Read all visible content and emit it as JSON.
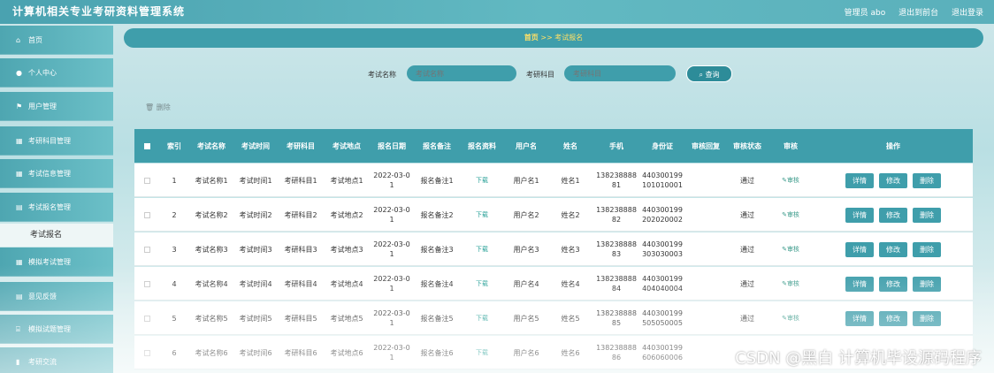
{
  "app": {
    "title": "计算机相关专业考研资料管理系统",
    "user": "管理员 abo",
    "front_link": "退出到前台",
    "logout": "退出登录"
  },
  "sidebar": {
    "items": [
      {
        "label": "首页",
        "icon": "home-icon"
      },
      {
        "label": "个人中心",
        "icon": "user-icon"
      },
      {
        "label": "用户管理",
        "icon": "flag-icon"
      },
      {
        "label": "考研科目管理",
        "icon": "grid-icon"
      },
      {
        "label": "考试信息管理",
        "icon": "grid-icon"
      },
      {
        "label": "考试报名管理",
        "icon": "doc-icon"
      },
      {
        "label": "模拟考试管理",
        "icon": "grid-icon"
      },
      {
        "label": "意见反馈",
        "icon": "doc-icon"
      },
      {
        "label": "模拟试题管理",
        "icon": "bank-icon"
      },
      {
        "label": "考研交流",
        "icon": "chart-icon"
      }
    ],
    "active_sub": "考试报名"
  },
  "breadcrumb": {
    "home": "首页",
    "sep": ">>",
    "current": "考试报名"
  },
  "search": {
    "name_label": "考试名称",
    "name_placeholder": "考试名称",
    "subject_label": "考研科目",
    "subject_placeholder": "考研科目",
    "button": "查询"
  },
  "toolbar": {
    "delete": "删除"
  },
  "table": {
    "headers": [
      "索引",
      "考试名称",
      "考试时间",
      "考研科目",
      "考试地点",
      "报名日期",
      "报名备注",
      "报名资料",
      "用户名",
      "姓名",
      "手机",
      "身份证",
      "审核回复",
      "审核状态",
      "审核",
      "操作"
    ],
    "rows": [
      {
        "idx": "1",
        "name": "考试名称1",
        "time": "考试时间1",
        "subject": "考研科目1",
        "place": "考试地点1",
        "date1": "2022-03-0",
        "date2": "1",
        "note": "报名备注1",
        "file": "下载",
        "user": "用户名1",
        "real": "姓名1",
        "phone1": "138238888",
        "phone2": "81",
        "id1": "440300199",
        "id2": "101010001",
        "reply": "",
        "status": "通过",
        "audit": "审核"
      },
      {
        "idx": "2",
        "name": "考试名称2",
        "time": "考试时间2",
        "subject": "考研科目2",
        "place": "考试地点2",
        "date1": "2022-03-0",
        "date2": "1",
        "note": "报名备注2",
        "file": "下载",
        "user": "用户名2",
        "real": "姓名2",
        "phone1": "138238888",
        "phone2": "82",
        "id1": "440300199",
        "id2": "202020002",
        "reply": "",
        "status": "通过",
        "audit": "审核"
      },
      {
        "idx": "3",
        "name": "考试名称3",
        "time": "考试时间3",
        "subject": "考研科目3",
        "place": "考试地点3",
        "date1": "2022-03-0",
        "date2": "1",
        "note": "报名备注3",
        "file": "下载",
        "user": "用户名3",
        "real": "姓名3",
        "phone1": "138238888",
        "phone2": "83",
        "id1": "440300199",
        "id2": "303030003",
        "reply": "",
        "status": "通过",
        "audit": "审核"
      },
      {
        "idx": "4",
        "name": "考试名称4",
        "time": "考试时间4",
        "subject": "考研科目4",
        "place": "考试地点4",
        "date1": "2022-03-0",
        "date2": "1",
        "note": "报名备注4",
        "file": "下载",
        "user": "用户名4",
        "real": "姓名4",
        "phone1": "138238888",
        "phone2": "84",
        "id1": "440300199",
        "id2": "404040004",
        "reply": "",
        "status": "通过",
        "audit": "审核"
      },
      {
        "idx": "5",
        "name": "考试名称5",
        "time": "考试时间5",
        "subject": "考研科目5",
        "place": "考试地点5",
        "date1": "2022-03-0",
        "date2": "1",
        "note": "报名备注5",
        "file": "下载",
        "user": "用户名5",
        "real": "姓名5",
        "phone1": "138238888",
        "phone2": "85",
        "id1": "440300199",
        "id2": "505050005",
        "reply": "",
        "status": "通过",
        "audit": "审核"
      },
      {
        "idx": "6",
        "name": "考试名称6",
        "time": "考试时间6",
        "subject": "考研科目6",
        "place": "考试地点6",
        "date1": "2022-03-0",
        "date2": "1",
        "note": "报名备注6",
        "file": "下载",
        "user": "用户名6",
        "real": "姓名6",
        "phone1": "138238888",
        "phone2": "86",
        "id1": "440300199",
        "id2": "606060006",
        "reply": "",
        "status": "",
        "audit": ""
      }
    ],
    "actions": {
      "detail": "详情",
      "edit": "修改",
      "delete": "删除"
    }
  },
  "watermark": "CSDN @黑白  计算机毕设源码程序",
  "colors": {
    "primary": "#3f9eab",
    "accent": "#ffe066"
  }
}
